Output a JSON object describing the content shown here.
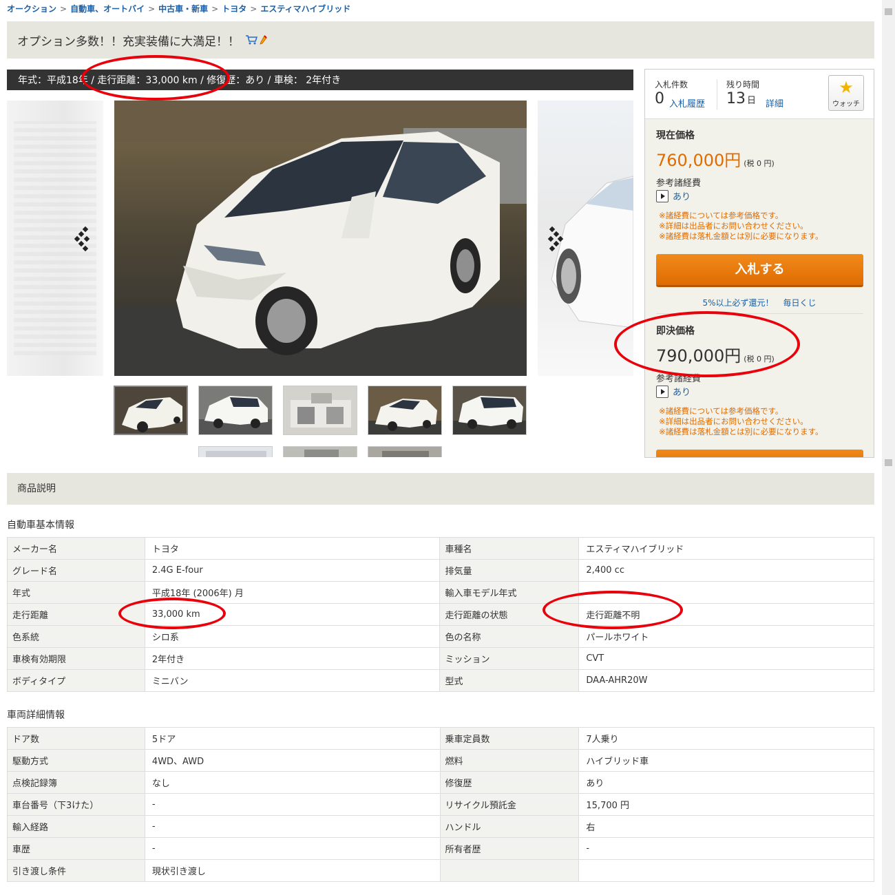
{
  "breadcrumb": [
    "オークション",
    "自動車、オートバイ",
    "中古車・新車",
    "トヨタ",
    "エスティマハイブリッド"
  ],
  "breadcrumb_sep": ">",
  "title": "オプション多数！！充実装備に大満足！！",
  "spec_bar": "年式：平成18年 / 走行距離：33,000 km / 修復歴：あり / 車検： 2年付き",
  "gallery": {
    "prev_icon": "chevron-left-icon",
    "next_icon": "chevron-right-icon"
  },
  "bid": {
    "count_label": "入札件数",
    "count_value": "0",
    "history_link": "入札履歴",
    "time_label": "残り時間",
    "time_value": "13",
    "time_unit": "日",
    "detail_link": "詳細",
    "watch_label": "ウォッチ"
  },
  "price": {
    "current_label": "現在価格",
    "current_value": "760,000円",
    "current_tax": "(税 0 円)",
    "fees_label": "参考諸経費",
    "fees_link": "あり",
    "notes": [
      "※諸経費については参考価格です。",
      "※詳細は出品者にお問い合わせください。",
      "※諸経費は落札金額とは別に必要になります。"
    ],
    "bid_button": "入札する",
    "promo_1": "5%以上必ず還元！",
    "promo_2": "毎日くじ",
    "buynow_label": "即決価格",
    "buynow_value": "790,000円",
    "buynow_tax": "(税 0 円)",
    "fees2_label": "参考諸経費",
    "fees2_link": "あり"
  },
  "description_header": "商品説明",
  "basic": {
    "heading": "自動車基本情報",
    "rows": [
      [
        "メーカー名",
        "トヨタ",
        "車種名",
        "エスティマハイブリッド"
      ],
      [
        "グレード名",
        "2.4G E-four",
        "排気量",
        "2,400 cc"
      ],
      [
        "年式",
        "平成18年 (2006年) 月",
        "輸入車モデル年式",
        ""
      ],
      [
        "走行距離",
        "33,000 km",
        "走行距離の状態",
        "走行距離不明"
      ],
      [
        "色系統",
        "シロ系",
        "色の名称",
        "パールホワイト"
      ],
      [
        "車検有効期限",
        "2年付き",
        "ミッション",
        "CVT"
      ],
      [
        "ボディタイプ",
        "ミニバン",
        "型式",
        "DAA-AHR20W"
      ]
    ]
  },
  "detail": {
    "heading": "車両詳細情報",
    "rows": [
      [
        "ドア数",
        "5ドア",
        "乗車定員数",
        "7人乗り"
      ],
      [
        "駆動方式",
        "4WD、AWD",
        "燃料",
        "ハイブリッド車"
      ],
      [
        "点検記録簿",
        "なし",
        "修復歴",
        "あり"
      ],
      [
        "車台番号（下3けた）",
        "-",
        "リサイクル預託金",
        "15,700 円"
      ],
      [
        "輸入経路",
        "-",
        "ハンドル",
        "右"
      ],
      [
        "車歴",
        "-",
        "所有者歴",
        "-"
      ],
      [
        "引き渡し条件",
        "現状引き渡し",
        "",
        ""
      ]
    ]
  },
  "colors": {
    "accent_orange": "#e06c00",
    "link_blue": "#1a5fa5",
    "annotation_red": "#e8000b"
  }
}
